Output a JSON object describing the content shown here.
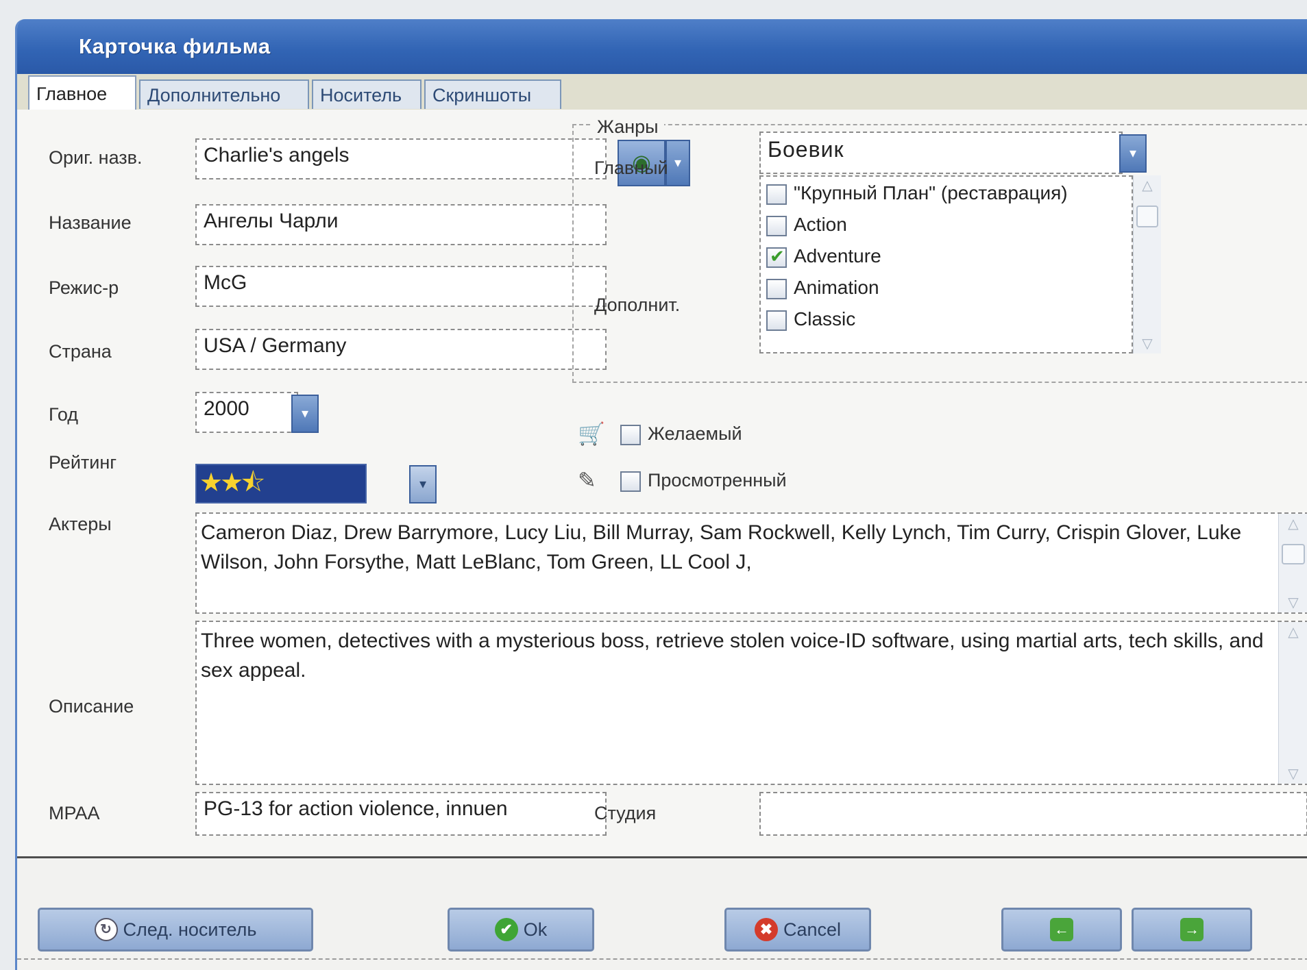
{
  "window": {
    "title": "Карточка фильма"
  },
  "tabs": [
    {
      "label": "Главное",
      "active": true
    },
    {
      "label": "Дополнительно",
      "active": false
    },
    {
      "label": "Носитель",
      "active": false
    },
    {
      "label": "Скриншоты",
      "active": false
    }
  ],
  "fields": {
    "orig_name": {
      "label": "Ориг. назв.",
      "value": "Charlie's angels"
    },
    "name": {
      "label": "Название",
      "value": "Ангелы Чарли"
    },
    "director": {
      "label": "Режис-р",
      "value": "McG"
    },
    "country": {
      "label": "Страна",
      "value": "USA / Germany"
    },
    "year": {
      "label": "Год",
      "value": "2000"
    },
    "rating": {
      "label": "Рейтинг",
      "value": 2.5,
      "max": 5
    },
    "actors": {
      "label": "Актеры",
      "value": "Cameron Diaz, Drew Barrymore, Lucy Liu, Bill Murray, Sam Rockwell, Kelly Lynch, Tim Curry, Crispin Glover, Luke Wilson, John Forsythe, Matt LeBlanc, Tom Green, LL Cool J,"
    },
    "description": {
      "label": "Описание",
      "value": "Three women, detectives with a mysterious boss, retrieve stolen voice-ID software, using martial arts, tech skills, and sex appeal."
    },
    "mpaa": {
      "label": "MPAA",
      "value": "PG-13 for action violence, innuen"
    },
    "studio": {
      "label": "Студия",
      "value": ""
    }
  },
  "genres": {
    "legend": "Жанры",
    "main_label": "Главный",
    "main_value": "Боевик",
    "extra_label": "Дополнит.",
    "items": [
      {
        "label": "\"Крупный План\" (реставрация)",
        "checked": false
      },
      {
        "label": "Action",
        "checked": false
      },
      {
        "label": "Adventure",
        "checked": true
      },
      {
        "label": "Animation",
        "checked": false
      },
      {
        "label": "Classic",
        "checked": false
      }
    ]
  },
  "flags": {
    "wanted": {
      "label": "Желаемый",
      "checked": false
    },
    "watched": {
      "label": "Просмотренный",
      "checked": false
    }
  },
  "buttons": {
    "next_media": "След. носитель",
    "ok": "Ok",
    "cancel": "Cancel"
  },
  "colors": {
    "titlebar": "#3265b5",
    "rating_bg": "#22408f",
    "star": "#f7d22e",
    "ok_icon": "#3fa535",
    "cancel_icon": "#d43b2b",
    "nav_icon": "#4aa53a"
  },
  "icons": {
    "web_search": "globe-icon",
    "wanted": "cart-icon",
    "watched": "pencil-icon"
  }
}
